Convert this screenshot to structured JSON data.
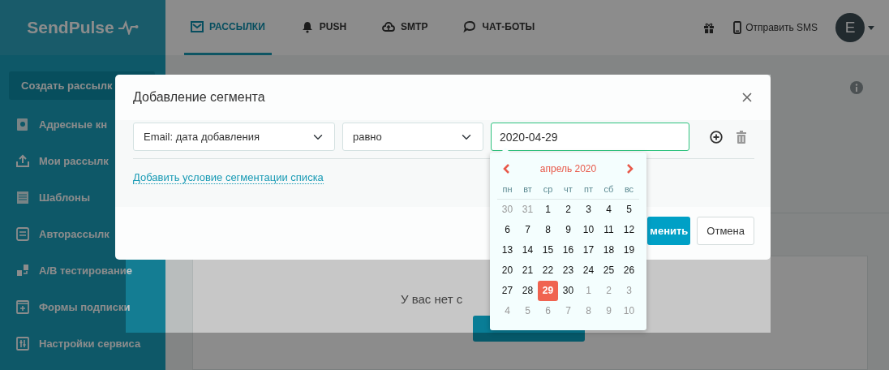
{
  "topbar": {
    "logo": "SendPulse",
    "nav": [
      {
        "label": "РАССЫЛКИ",
        "selected": true
      },
      {
        "label": "PUSH",
        "selected": false
      },
      {
        "label": "SMTP",
        "selected": false
      },
      {
        "label": "ЧАТ-БОТЫ",
        "selected": false
      }
    ],
    "sms": "Отправить SMS",
    "avatar": "E"
  },
  "sidebar": {
    "create_button": "Создать рассылк",
    "items": [
      {
        "label": "Адресные кн"
      },
      {
        "label": "Мои рассылк"
      },
      {
        "label": "Шаблоны"
      },
      {
        "label": "Авторассылк"
      },
      {
        "label": "A/B тестирование"
      },
      {
        "label": "Формы подписки"
      },
      {
        "label": "Настройки сервиса"
      }
    ]
  },
  "content": {
    "empty_text": "У вас нет с"
  },
  "modal": {
    "title": "Добавление сегмента",
    "condition": {
      "field": "Email: дата добавления",
      "operator": "равно",
      "value": "2020-04-29"
    },
    "add_condition_link": "Добавить условие сегментации списка",
    "buttons": [
      {
        "label": "менить",
        "kind": "primary"
      },
      {
        "label": "Отмена",
        "kind": "secondary"
      }
    ]
  },
  "datepicker": {
    "month": "апрель 2020",
    "weekdays": [
      "пн",
      "вт",
      "ср",
      "чт",
      "пт",
      "сб",
      "вс"
    ],
    "weeks": [
      [
        {
          "day": "30",
          "other_month": true,
          "selected": false
        },
        {
          "day": "31",
          "other_month": true,
          "selected": false
        },
        {
          "day": "1",
          "other_month": false,
          "selected": false
        },
        {
          "day": "2",
          "other_month": false,
          "selected": false
        },
        {
          "day": "3",
          "other_month": false,
          "selected": false
        },
        {
          "day": "4",
          "other_month": false,
          "selected": false
        },
        {
          "day": "5",
          "other_month": false,
          "selected": false
        }
      ],
      [
        {
          "day": "6",
          "other_month": false,
          "selected": false
        },
        {
          "day": "7",
          "other_month": false,
          "selected": false
        },
        {
          "day": "8",
          "other_month": false,
          "selected": false
        },
        {
          "day": "9",
          "other_month": false,
          "selected": false
        },
        {
          "day": "10",
          "other_month": false,
          "selected": false
        },
        {
          "day": "11",
          "other_month": false,
          "selected": false
        },
        {
          "day": "12",
          "other_month": false,
          "selected": false
        }
      ],
      [
        {
          "day": "13",
          "other_month": false,
          "selected": false
        },
        {
          "day": "14",
          "other_month": false,
          "selected": false
        },
        {
          "day": "15",
          "other_month": false,
          "selected": false
        },
        {
          "day": "16",
          "other_month": false,
          "selected": false
        },
        {
          "day": "17",
          "other_month": false,
          "selected": false
        },
        {
          "day": "18",
          "other_month": false,
          "selected": false
        },
        {
          "day": "19",
          "other_month": false,
          "selected": false
        }
      ],
      [
        {
          "day": "20",
          "other_month": false,
          "selected": false
        },
        {
          "day": "21",
          "other_month": false,
          "selected": false
        },
        {
          "day": "22",
          "other_month": false,
          "selected": false
        },
        {
          "day": "23",
          "other_month": false,
          "selected": false
        },
        {
          "day": "24",
          "other_month": false,
          "selected": false
        },
        {
          "day": "25",
          "other_month": false,
          "selected": false
        },
        {
          "day": "26",
          "other_month": false,
          "selected": false
        }
      ],
      [
        {
          "day": "27",
          "other_month": false,
          "selected": false
        },
        {
          "day": "28",
          "other_month": false,
          "selected": false
        },
        {
          "day": "29",
          "other_month": false,
          "selected": true
        },
        {
          "day": "30",
          "other_month": false,
          "selected": false
        },
        {
          "day": "1",
          "other_month": true,
          "selected": false
        },
        {
          "day": "2",
          "other_month": true,
          "selected": false
        },
        {
          "day": "3",
          "other_month": true,
          "selected": false
        }
      ],
      [
        {
          "day": "4",
          "other_month": true,
          "selected": false
        },
        {
          "day": "5",
          "other_month": true,
          "selected": false
        },
        {
          "day": "6",
          "other_month": true,
          "selected": false
        },
        {
          "day": "7",
          "other_month": true,
          "selected": false
        },
        {
          "day": "8",
          "other_month": true,
          "selected": false
        },
        {
          "day": "9",
          "other_month": true,
          "selected": false
        },
        {
          "day": "10",
          "other_month": true,
          "selected": false
        }
      ]
    ]
  }
}
